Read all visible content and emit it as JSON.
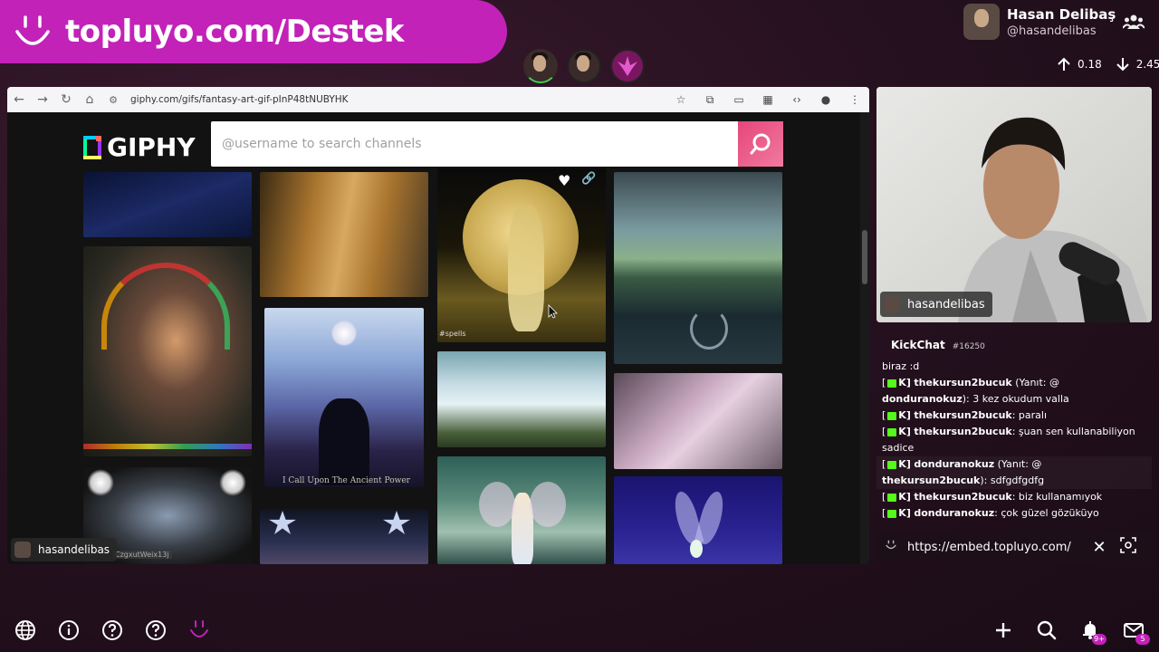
{
  "brand": {
    "text": "topluyo.com/Destek"
  },
  "profile": {
    "name": "Hasan Delibaş",
    "handle": "@hasandelibas"
  },
  "stats": {
    "upload": "0.18",
    "download": "2.45"
  },
  "browser": {
    "url": "giphy.com/gifs/fantasy-art-gif-pInP48tNUBYHK",
    "site_name": "GIPHY",
    "search_placeholder": "@username to search channels",
    "captions": {
      "spells": "#spells",
      "ancient": "I Call Upon The Ancient Power",
      "user_tag": "CzgxutWeix13j"
    }
  },
  "streamer_tag": "hasandelibas",
  "webcam_tag": "hasandelibas",
  "chat": {
    "title": "KickChat",
    "count": "#16250",
    "lines": [
      {
        "prefix": "",
        "user": "",
        "text": "biraz :d"
      },
      {
        "prefix": "[",
        "badge_label": "K]",
        "user": "thekursun2bucuk",
        "text": " (Yanıt: @"
      },
      {
        "prefix": "",
        "user": "donduranokuz",
        "text": "): 3 kez okudum valla"
      },
      {
        "prefix": "[",
        "badge_label": "K]",
        "user": "thekursun2bucuk",
        "text": ": paralı"
      },
      {
        "prefix": "[",
        "badge_label": "K]",
        "user": "thekursun2bucuk",
        "text": ": şuan sen kullanabiliyon"
      },
      {
        "prefix": "",
        "user": "",
        "text": "sadice"
      },
      {
        "prefix": "[",
        "badge_label": "K]",
        "user": "donduranokuz",
        "text": " (Yanıt: @"
      },
      {
        "prefix": "",
        "user": "thekursun2bucuk",
        "text": "): sdfgdfgdfg"
      },
      {
        "prefix": "[",
        "badge_label": "K]",
        "user": "thekursun2bucuk",
        "text": ": biz kullanamıyok"
      },
      {
        "prefix": "[",
        "badge_label": "K]",
        "user": "donduranokuz",
        "text": ": çok güzel gözüküyo"
      }
    ]
  },
  "embed": {
    "url": "https://embed.topluyo.com/"
  },
  "badges": {
    "notifications": "9+",
    "messages": "5"
  },
  "colors": {
    "brand": "#c222b8",
    "search_button": "#e6467a",
    "kick_green": "#53fc18"
  }
}
